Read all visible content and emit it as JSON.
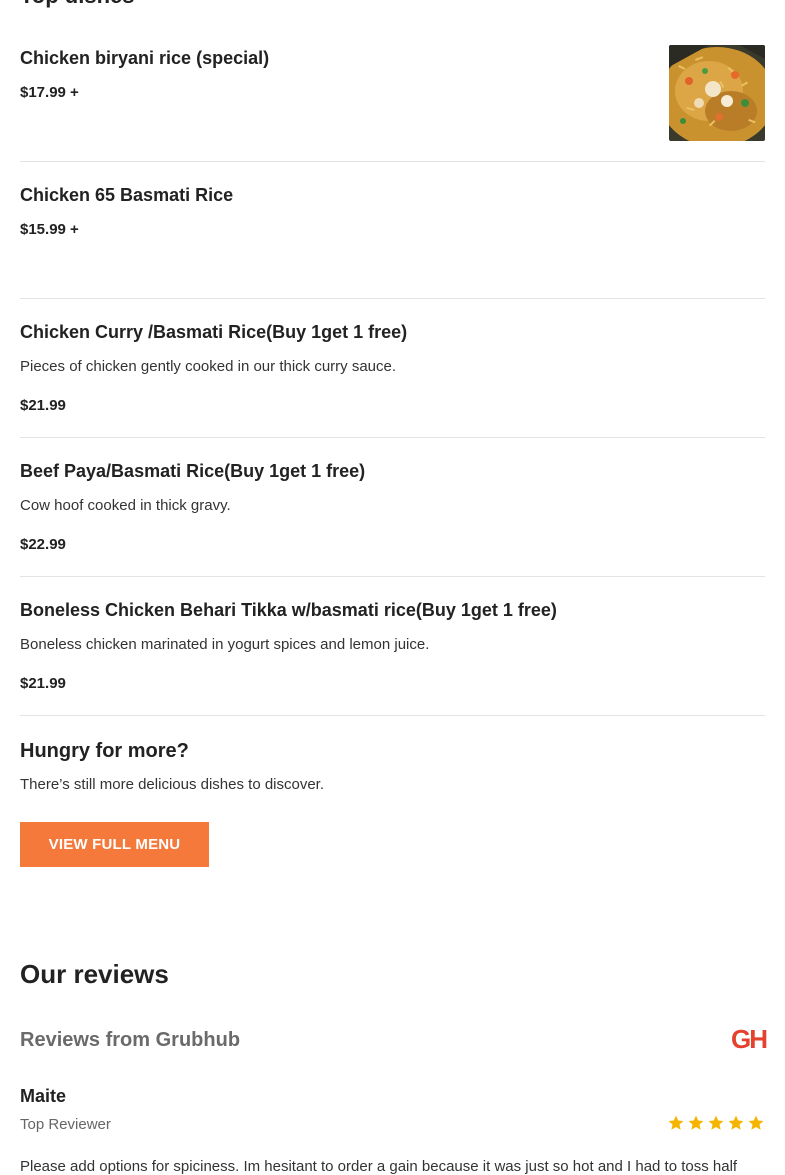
{
  "top_dishes": {
    "title": "Top dishes",
    "items": [
      {
        "name": "Chicken biryani rice (special)",
        "description": "",
        "price": "$17.99 +",
        "has_photo": true
      },
      {
        "name": "Chicken 65 Basmati Rice",
        "description": "",
        "price": "$15.99 +",
        "has_photo": false
      },
      {
        "name": "Chicken Curry /Basmati Rice(Buy 1get 1 free)",
        "description": "Pieces of chicken gently cooked in our thick curry sauce.",
        "price": "$21.99",
        "has_photo": false
      },
      {
        "name": "Beef Paya/Basmati Rice(Buy 1get 1 free)",
        "description": "Cow hoof cooked in thick gravy.",
        "price": "$22.99",
        "has_photo": false
      },
      {
        "name": "Boneless Chicken Behari Tikka w/basmati rice(Buy 1get 1 free)",
        "description": "Boneless chicken marinated in yogurt spices and lemon juice.",
        "price": "$21.99",
        "has_photo": false
      }
    ]
  },
  "more": {
    "title": "Hungry for more?",
    "subtitle": "There’s still more delicious dishes to discover.",
    "button_label": "VIEW FULL MENU",
    "button_color": "#f5793b"
  },
  "reviews": {
    "title": "Our reviews",
    "source_title": "Reviews from Grubhub",
    "source_logo": "GH",
    "source_logo_color": "#e4412f",
    "review": {
      "name": "Maite",
      "tag": "Top Reviewer",
      "rating": 5,
      "rating_max": 5,
      "text": "Please add options for spiciness. Im hesitant to order a gain because it was just so hot and I had to toss half"
    }
  },
  "colors": {
    "accent": "#f5793b",
    "star": "#f4b400",
    "divider": "#e3e3e3"
  }
}
